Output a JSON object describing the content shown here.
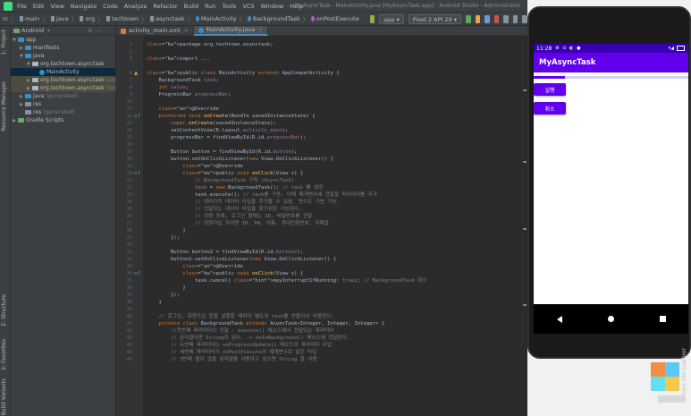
{
  "window": {
    "title": "MyAsyncTask - MainActivity.java [MyAsyncTask.app] - Android Studio - Administrator"
  },
  "menu": [
    "File",
    "Edit",
    "View",
    "Navigate",
    "Code",
    "Analyze",
    "Refactor",
    "Build",
    "Run",
    "Tools",
    "VCS",
    "Window",
    "Help"
  ],
  "breadcrumbs": [
    "rc",
    "main",
    "java",
    "org",
    "techtown",
    "asynctask",
    "MainActivity",
    "BackgroundTask",
    "onPostExecute"
  ],
  "toolbar": {
    "run_config": "app",
    "device": "Pixel 2 API 29"
  },
  "left_tabs": [
    "1: Project",
    "Resource Manager",
    "Z: Structure",
    "2: Favorites",
    "Build Variants"
  ],
  "right_tabs": [
    "Device File Explorer"
  ],
  "project_panel": {
    "view_selector": "Android",
    "tree": [
      {
        "label": "app",
        "depth": 0,
        "icon": "folder-icon",
        "expanded": true
      },
      {
        "label": "manifests",
        "depth": 1,
        "icon": "folder-icon",
        "expanded": false
      },
      {
        "label": "java",
        "depth": 1,
        "icon": "folder-icon",
        "expanded": true
      },
      {
        "label": "org.techtown.asynctask",
        "depth": 2,
        "icon": "package-icon",
        "expanded": true
      },
      {
        "label": "MainActivity",
        "depth": 3,
        "icon": "class-icon",
        "selected": true
      },
      {
        "label": "org.techtown.asynctask",
        "suffix": "(androidTest)",
        "depth": 2,
        "icon": "package-icon",
        "highlight": true
      },
      {
        "label": "org.techtown.asynctask",
        "suffix": "(test)",
        "depth": 2,
        "icon": "package-icon",
        "highlight": true
      },
      {
        "label": "java",
        "suffix": "(generated)",
        "depth": 1,
        "icon": "folder-icon"
      },
      {
        "label": "res",
        "depth": 1,
        "icon": "folder-icon"
      },
      {
        "label": "res",
        "suffix": "(generated)",
        "depth": 1,
        "icon": "folder-icon"
      },
      {
        "label": "Gradle Scripts",
        "depth": 0,
        "icon": "gradle-icon"
      }
    ]
  },
  "editor_tabs": [
    {
      "label": "activity_main.xml",
      "active": false,
      "color": "#e07a30"
    },
    {
      "label": "MainActivity.java",
      "active": true,
      "color": "#3592c4"
    }
  ],
  "code": {
    "line_numbers": [
      "1",
      "2",
      "3",
      "",
      "6",
      "7",
      "8",
      "9",
      "10",
      "11",
      "12",
      "13",
      "14",
      "15",
      "16",
      "17",
      "18",
      "19",
      "20",
      "21",
      "22",
      "23",
      "24",
      "25",
      "26",
      "27",
      "28",
      "29",
      "30",
      "31",
      "32",
      "33",
      "34",
      "35",
      "36",
      "37",
      "38",
      "39",
      "40",
      "41",
      "42",
      "43",
      "44",
      "45",
      "46",
      "47",
      "48",
      "49",
      "50"
    ],
    "lines": [
      "package org.techtown.asynctask;",
      "",
      "import ...",
      "",
      "public class MainActivity extends AppCompatActivity {",
      "    BackgroundTask task;",
      "    int value;",
      "    ProgressBar progressBar;",
      "",
      "    @Override",
      "    protected void onCreate(Bundle savedInstanceState) {",
      "        super.onCreate(savedInstanceState);",
      "        setContentView(R.layout.activity_main);",
      "        progressBar = findViewById(R.id.progressBar);",
      "",
      "        Button button = findViewById(R.id.button);",
      "        button.setOnClickListener(new View.OnClickListener() {",
      "            @Override",
      "            public void onClick(View v) {",
      "                // BackgroundTask 구동 (AsyncTask)",
      "                task = new BackgroundTask(); // task 를 생성",
      "                task.execute(); // task를 구동. 이때 매개변수에 전달할 파라미터를 추가",
      "                // 여러가지 데이터 타입을 추가할 수 있음. 변수도 가변 가능",
      "                // 전달되는 데이터 타입을 찾기위한 가능하다.",
      "                // 회원 등록, 로그인 할때는 ID, 비밀번호를 전달",
      "                // 회원가입 하려면 ID, PW, 이름, 휴대전화번호, 이메일",
      "            }",
      "        });",
      "",
      "        Button button2 = findViewById(R.id.button2);",
      "        button2.setOnClickListener(new View.OnClickListener() {",
      "            @Override",
      "            public void onClick(View v) {",
      "                task.cancel( mayInterruptIfRunning: true); // BackgroundTask 취소",
      "            }",
      "        });",
      "    }",
      "",
      "    // 로그인, 회원가입 등을 실행할 때마다 별도의 task를 만들어서 사용한다.",
      "    private class BackgroundTask extends AsyncTask<Integer, Integer, Integer> {",
      "        //첫번째 파라미터의 전달 : execute() 메소드에서 전달되는 파라미터",
      "        // 문자열이면 String이 된다. -> doInBackground() 메소드에 전달된다.",
      "        // 두번째 파라미터는 onProgressUpdate() 메소드의 파라미터 타입",
      "        // 세번째 파라미터가 onPostExecute의 매개변수로 같은 타입",
      "        // 3번째 결과 값을 문자열을 사용하고 싶으면 String 을 사용"
    ]
  },
  "emulator": {
    "status_time": "11:28",
    "status_icons": "⚙ ⊙ ◐ ●",
    "signal": "▾◢",
    "app_title": "MyAsyncTask",
    "progress": 0.2,
    "button_run": "실행",
    "button_cancel": "취소",
    "accent": "#6200ee",
    "status_color": "#3700b3"
  }
}
